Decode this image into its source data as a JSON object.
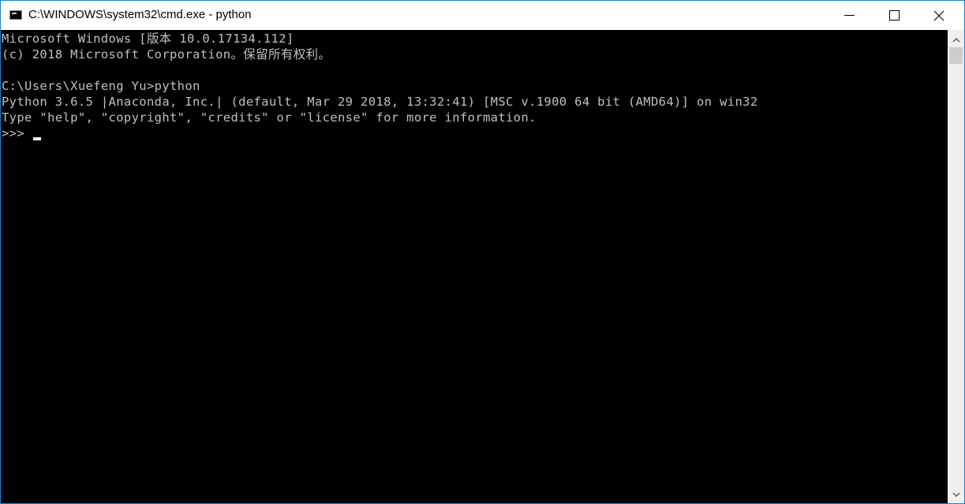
{
  "window": {
    "title": "C:\\WINDOWS\\system32\\cmd.exe - python",
    "controls": {
      "minimize": "minimize",
      "maximize": "maximize",
      "close": "close"
    }
  },
  "console": {
    "lines": [
      "Microsoft Windows [版本 10.0.17134.112]",
      "(c) 2018 Microsoft Corporation。保留所有权利。",
      "",
      "C:\\Users\\Xuefeng Yu>python",
      "Python 3.6.5 |Anaconda, Inc.| (default, Mar 29 2018, 13:32:41) [MSC v.1900 64 bit (AMD64)] on win32",
      "Type \"help\", \"copyright\", \"credits\" or \"license\" for more information.",
      ">>> "
    ]
  },
  "colors": {
    "border": "#1883d7",
    "console_bg": "#000000",
    "console_fg": "#c0c0c0"
  }
}
